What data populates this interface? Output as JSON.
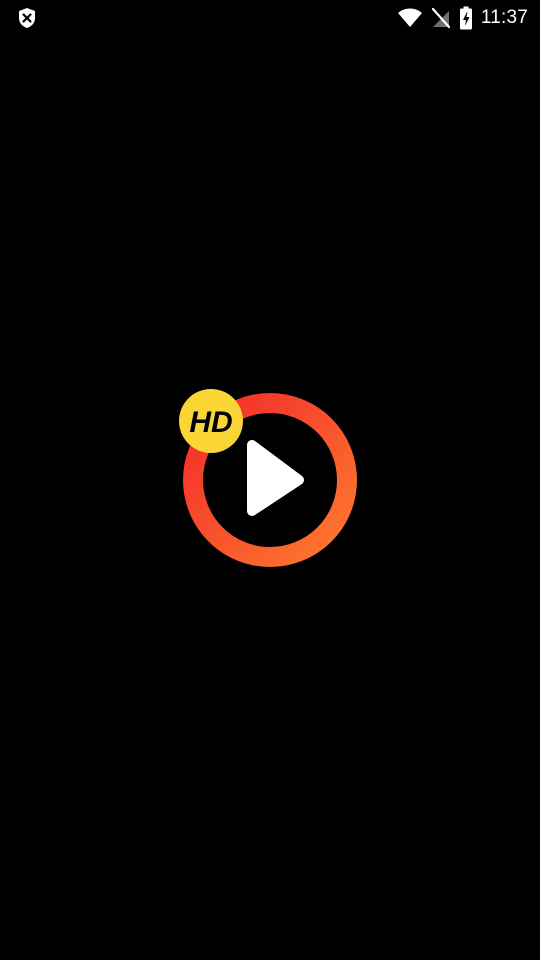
{
  "status_bar": {
    "time": "11:37",
    "icons": {
      "left": "shield-x-icon",
      "wifi": "wifi-icon",
      "signal": "signal-off-icon",
      "battery": "battery-charging-icon"
    },
    "text_color": "#ffffff"
  },
  "splash": {
    "background_color": "#000000",
    "logo": {
      "badge_text": "HD",
      "badge_color": "#f9d635",
      "ring_gradient": [
        "#f22a2a",
        "#ff7a2e"
      ],
      "play_color": "#ffffff",
      "icons": {
        "ring": "ring-icon",
        "play": "play-icon",
        "badge": "hd-badge-icon"
      }
    }
  }
}
